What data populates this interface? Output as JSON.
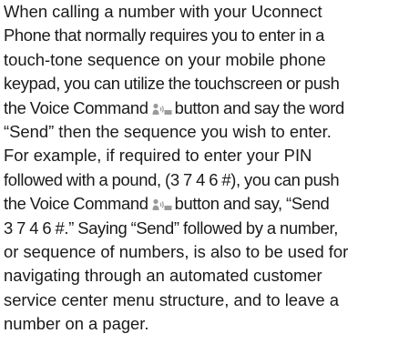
{
  "paragraph": {
    "line1": "When calling a number with your Uconnect",
    "line2": "Phone that normally requires you to enter in a",
    "line3": "touch-tone sequence on your mobile phone",
    "line4": "keypad, you can utilize the touchscreen or push",
    "line5_before": "the Voice Command",
    "line5_after": "button and say the word",
    "line6": "“Send” then the sequence you wish to enter.",
    "line7": "For example, if required to enter your PIN",
    "line8": "followed with a pound, (3 7 4 6 #), you can push",
    "line9_before": "the Voice Command",
    "line9_after": "button and say, “Send",
    "line10": "3 7 4 6 #.” Saying “Send” followed by a number,",
    "line11": "or sequence of numbers, is also to be used for",
    "line12": "navigating through an automated customer",
    "line13": "service center menu structure, and to leave a",
    "line14": "number on a pager."
  },
  "icons": {
    "voice_command": "voice-command-icon",
    "icon_color": "#9a9a9a"
  },
  "colors": {
    "text": "#1a1a1a",
    "background": "#ffffff"
  }
}
